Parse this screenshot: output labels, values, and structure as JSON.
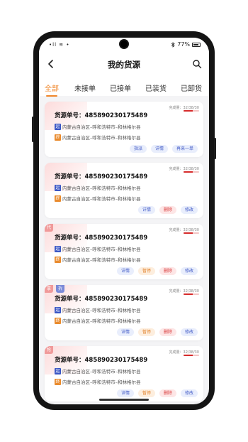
{
  "status": {
    "left": "•ll ≋ •",
    "battery_text": "77%"
  },
  "header": {
    "title": "我的货源"
  },
  "tabs": [
    {
      "label": "全部",
      "active": true
    },
    {
      "label": "未接单"
    },
    {
      "label": "已接单"
    },
    {
      "label": "已装货"
    },
    {
      "label": "已卸货"
    }
  ],
  "progress_label": "完成量：32/38/30",
  "cards": [
    {
      "order_label": "货源单号：",
      "order_no": "485890230175489",
      "from_tag": "起",
      "from": "内蒙古自治区–呼和浩特市–和林格尔县",
      "to_tag": "终",
      "to": "内蒙古自治区–呼和浩特市–和林格尔县",
      "progress_fill": 0.6,
      "actions": [
        {
          "label": "指派",
          "style": "blue"
        },
        {
          "label": "详情",
          "style": "blue"
        },
        {
          "label": "再来一单",
          "style": "blue"
        }
      ]
    },
    {
      "order_label": "货源单号：",
      "order_no": "485890230175489",
      "from_tag": "起",
      "from": "内蒙古自治区–呼和浩特市–和林格尔县",
      "to_tag": "终",
      "to": "内蒙古自治区–呼和浩特市–和林格尔县",
      "progress_fill": 0.6,
      "actions": [
        {
          "label": "详情",
          "style": "blue"
        },
        {
          "label": "删除",
          "style": "red"
        },
        {
          "label": "修改",
          "style": "blue"
        }
      ]
    },
    {
      "corner": "代",
      "order_label": "货源单号：",
      "order_no": "485890230175489",
      "from_tag": "起",
      "from": "内蒙古自治区–呼和浩特市–和林格尔县",
      "to_tag": "终",
      "to": "内蒙古自治区–呼和浩特市–和林格尔县",
      "progress_fill": 0.6,
      "actions": [
        {
          "label": "详情",
          "style": "blue"
        },
        {
          "label": "暂停",
          "style": "orange"
        },
        {
          "label": "删除",
          "style": "red"
        },
        {
          "label": "修改",
          "style": "blue"
        }
      ]
    },
    {
      "corner": "拿",
      "corner2": "拆",
      "order_label": "货源单号：",
      "order_no": "485890230175489",
      "from_tag": "起",
      "from": "内蒙古自治区–呼和浩特市–和林格尔县",
      "to_tag": "终",
      "to": "内蒙古自治区–呼和浩特市–和林格尔县",
      "progress_fill": 0.6,
      "actions": [
        {
          "label": "详情",
          "style": "blue"
        },
        {
          "label": "暂停",
          "style": "orange"
        },
        {
          "label": "删除",
          "style": "red"
        },
        {
          "label": "修改",
          "style": "blue"
        }
      ]
    },
    {
      "corner": "抢",
      "order_label": "货源单号：",
      "order_no": "485890230175489",
      "from_tag": "起",
      "from": "内蒙古自治区–呼和浩特市–和林格尔县",
      "to_tag": "终",
      "to": "内蒙古自治区–呼和浩特市–和林格尔县",
      "progress_fill": 0.6,
      "actions": [
        {
          "label": "详情",
          "style": "blue"
        },
        {
          "label": "暂停",
          "style": "orange"
        },
        {
          "label": "删除",
          "style": "red"
        },
        {
          "label": "修改",
          "style": "blue"
        }
      ]
    }
  ],
  "colors": {
    "accent": "#f0862a",
    "start_tag": "#3a55c4",
    "end_tag": "#e98a2c",
    "progress": "#d62b2b"
  },
  "icons": {
    "back": "back-arrow-icon",
    "search": "search-icon",
    "bluetooth": "bluetooth-icon",
    "battery": "battery-icon"
  }
}
